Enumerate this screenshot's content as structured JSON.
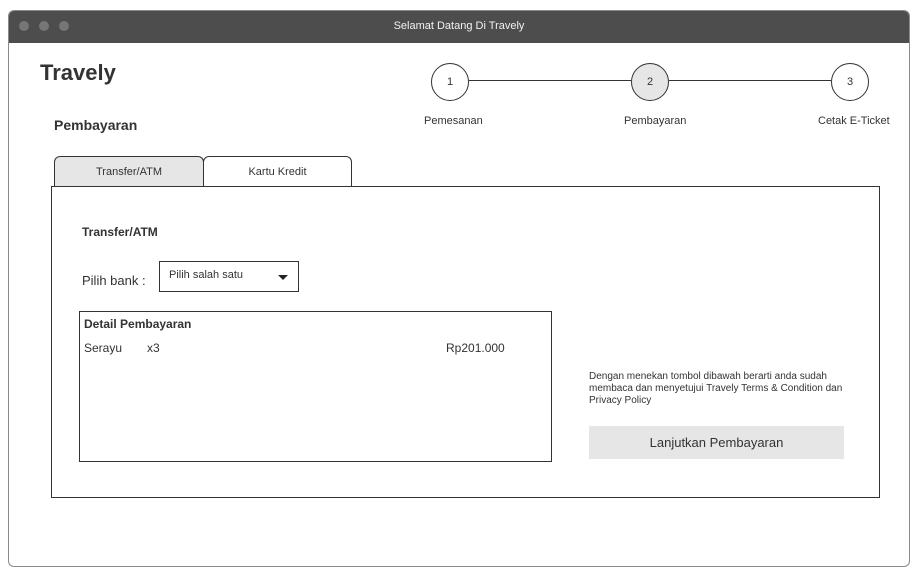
{
  "window": {
    "title": "Selamat Datang Di Travely"
  },
  "header": {
    "logo": "Travely",
    "page_title": "Pembayaran"
  },
  "steps": [
    {
      "number": "1",
      "label": "Pemesanan",
      "active": false
    },
    {
      "number": "2",
      "label": "Pembayaran",
      "active": true
    },
    {
      "number": "3",
      "label": "Cetak E-Ticket",
      "active": false
    }
  ],
  "tabs": [
    {
      "label": "Transfer/ATM",
      "selected": true
    },
    {
      "label": "Kartu Kredit",
      "selected": false
    }
  ],
  "payment": {
    "section_title": "Transfer/ATM",
    "bank_label": "Pilih bank :",
    "bank_select_value": "Pilih salah satu"
  },
  "detail": {
    "title": "Detail Pembayaran",
    "items": [
      {
        "name": "Serayu",
        "qty": "x3",
        "price": "Rp201.000"
      }
    ]
  },
  "terms_text": "Dengan menekan tombol dibawah berarti anda sudah membaca dan menyetujui Travely Terms & Condition dan Privacy Policy",
  "continue_button": "Lanjutkan Pembayaran",
  "colors": {
    "titlebar": "#4d4d4d",
    "active_fill": "#e6e6e6",
    "border": "#333333"
  }
}
